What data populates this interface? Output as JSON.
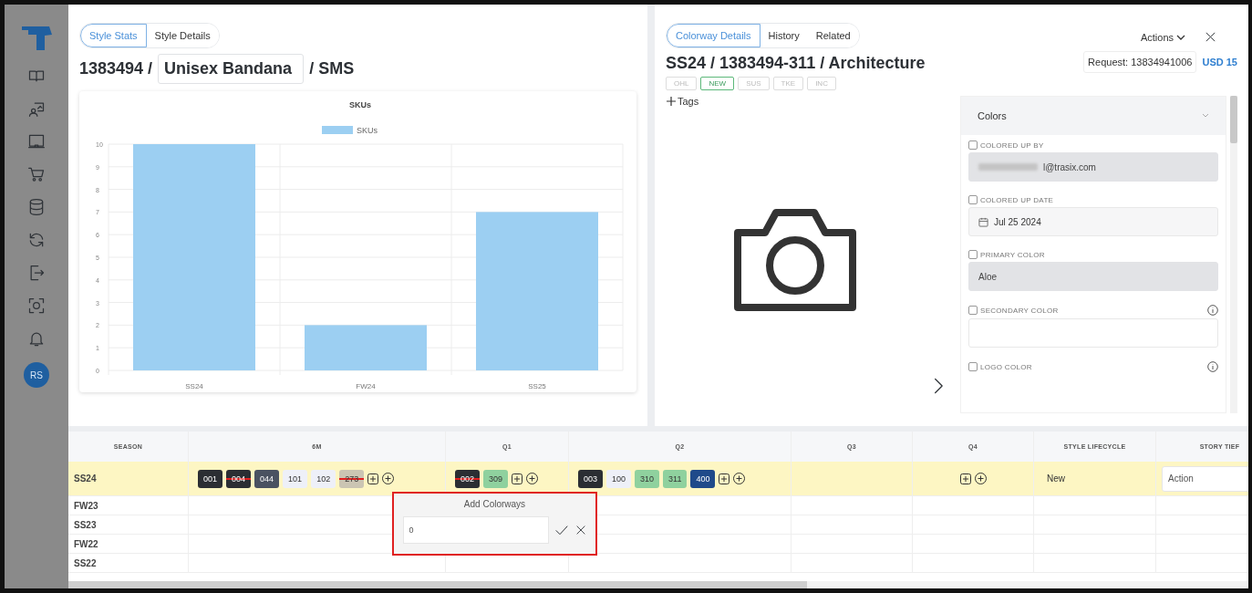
{
  "sidebar": {
    "avatar": "RS"
  },
  "style_panel": {
    "tabs": [
      {
        "label": "Style Stats",
        "selected": true
      },
      {
        "label": "Style Details",
        "selected": false
      }
    ],
    "title_prefix": "1383494 /",
    "name": "Unisex Bandana",
    "title_suffix": "/ SMS",
    "chart_data": {
      "type": "bar",
      "grid": true,
      "title": "SKUs",
      "categories": [
        "SS24",
        "FW24",
        "SS25"
      ],
      "series": [
        {
          "name": "SKUs",
          "color": "#9ccff2",
          "values": [
            10,
            2,
            7
          ]
        }
      ],
      "ylim": [
        0,
        10
      ],
      "yticks": [
        0,
        1,
        2,
        3,
        4,
        5,
        6,
        7,
        8,
        9,
        10
      ]
    }
  },
  "colorway_panel": {
    "tabs": [
      {
        "label": "Colorway Details",
        "selected": true
      },
      {
        "label": "History",
        "selected": false
      },
      {
        "label": "Related",
        "selected": false
      }
    ],
    "actions": "Actions",
    "request": "Request: 13834941006",
    "price": "USD 15",
    "title": "SS24 / 1383494-311 / Architecture",
    "badges": [
      {
        "label": "OHL",
        "selected": false
      },
      {
        "label": "NEW",
        "selected": true
      },
      {
        "label": "SUS",
        "selected": false
      },
      {
        "label": "TKE",
        "selected": false
      },
      {
        "label": "INC",
        "selected": false
      }
    ],
    "tags_button": "Tags",
    "colors": {
      "title": "Colors",
      "fields": [
        {
          "label": "COLORED UP BY",
          "checked": false,
          "kind": "email",
          "disabled": true,
          "value": "l@trasix.com",
          "info": false
        },
        {
          "label": "COLORED UP DATE",
          "checked": false,
          "kind": "date",
          "disabled": false,
          "value": "Jul 25 2024",
          "info": false
        },
        {
          "label": "PRIMARY COLOR",
          "checked": false,
          "kind": "text",
          "disabled": true,
          "value": "Aloe",
          "info": false
        },
        {
          "label": "SECONDARY COLOR",
          "checked": false,
          "kind": "text",
          "disabled": false,
          "info": true
        },
        {
          "label": "LOGO COLOR",
          "checked": false,
          "info": true
        }
      ]
    }
  },
  "grid": {
    "columns": [
      "SEASON",
      "6M",
      "Q1",
      "Q2",
      "Q3",
      "Q4",
      "STYLE LIFECYCLE",
      "STORY TIEF"
    ],
    "rows": [
      {
        "season": "SS24",
        "selected": true,
        "periods": [
          {
            "chips": [
              {
                "label": "001",
                "color": "#2b2e33",
                "struck": false
              },
              {
                "label": "004",
                "color": "#2b2e33",
                "struck": true
              },
              {
                "label": "044",
                "color": "#4a5261",
                "struck": false
              },
              {
                "label": "101",
                "color": "#eef0f8",
                "struck": false
              },
              {
                "label": "102",
                "color": "#eef0f8",
                "struck": false
              },
              {
                "label": "273",
                "color": "#cbc5b3",
                "struck": true
              }
            ],
            "add_buttons": true
          },
          {
            "chips": [
              {
                "label": "002",
                "color": "#2b2e33",
                "struck": true
              },
              {
                "label": "309",
                "color": "#8fd19e",
                "struck": false
              }
            ],
            "add_buttons": true
          },
          {
            "chips": [
              {
                "label": "003",
                "color": "#2b2e33",
                "struck": false
              },
              {
                "label": "100",
                "color": "#eef0f8",
                "struck": false
              },
              {
                "label": "310",
                "color": "#8fd19e",
                "struck": false
              },
              {
                "label": "311",
                "color": "#8fd19e",
                "struck": false
              },
              {
                "label": "400",
                "color": "#1f4a8a",
                "struck": false
              }
            ],
            "add_buttons": true
          },
          {
            "add_buttons": false
          },
          {
            "add_buttons": true
          }
        ],
        "lifecycle": "New",
        "story_tier": "Action"
      },
      {
        "season": "FW23",
        "selected": false
      },
      {
        "season": "SS23",
        "selected": false
      },
      {
        "season": "FW22",
        "selected": false
      },
      {
        "season": "SS22",
        "selected": false
      }
    ]
  },
  "add_colorways_popup": {
    "title": "Add Colorways",
    "value": "0"
  }
}
